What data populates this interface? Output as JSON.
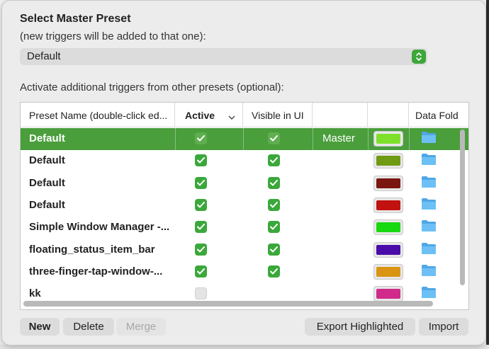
{
  "dialog": {
    "title": "Select Master Preset",
    "subtitle": "(new triggers will be added to that one):",
    "master_select": {
      "value": "Default"
    },
    "section_label": "Activate additional triggers from other presets (optional):"
  },
  "table": {
    "columns": [
      {
        "label": "Preset Name (double-click ed..."
      },
      {
        "label": "Active"
      },
      {
        "label": "Visible in UI"
      },
      {
        "label": ""
      },
      {
        "label": ""
      },
      {
        "label": "Data Fold"
      }
    ],
    "rows": [
      {
        "name": "Default",
        "active": true,
        "visible": true,
        "role": "Master",
        "color": "#7ee02a",
        "selected": true
      },
      {
        "name": "Default",
        "active": true,
        "visible": true,
        "role": "",
        "color": "#6f9a12",
        "selected": false
      },
      {
        "name": "Default",
        "active": true,
        "visible": true,
        "role": "",
        "color": "#7a1610",
        "selected": false
      },
      {
        "name": "Default",
        "active": true,
        "visible": true,
        "role": "",
        "color": "#c2120f",
        "selected": false
      },
      {
        "name": "Simple Window Manager -...",
        "active": true,
        "visible": true,
        "role": "",
        "color": "#18d80f",
        "selected": false
      },
      {
        "name": "floating_status_item_bar",
        "active": true,
        "visible": true,
        "role": "",
        "color": "#4a0ca8",
        "selected": false
      },
      {
        "name": "three-finger-tap-window-...",
        "active": true,
        "visible": true,
        "role": "",
        "color": "#d89412",
        "selected": false
      },
      {
        "name": "kk",
        "active": false,
        "visible": false,
        "role": "",
        "color": "#d02a8a",
        "selected": false
      }
    ]
  },
  "buttons": {
    "new": "New",
    "delete": "Delete",
    "merge": "Merge",
    "export_highlighted": "Export Highlighted",
    "import": "Import"
  },
  "colors": {
    "accent_green": "#4a9e3c",
    "check_green": "#3aa83a",
    "folder_blue": "#5ab4ee"
  }
}
